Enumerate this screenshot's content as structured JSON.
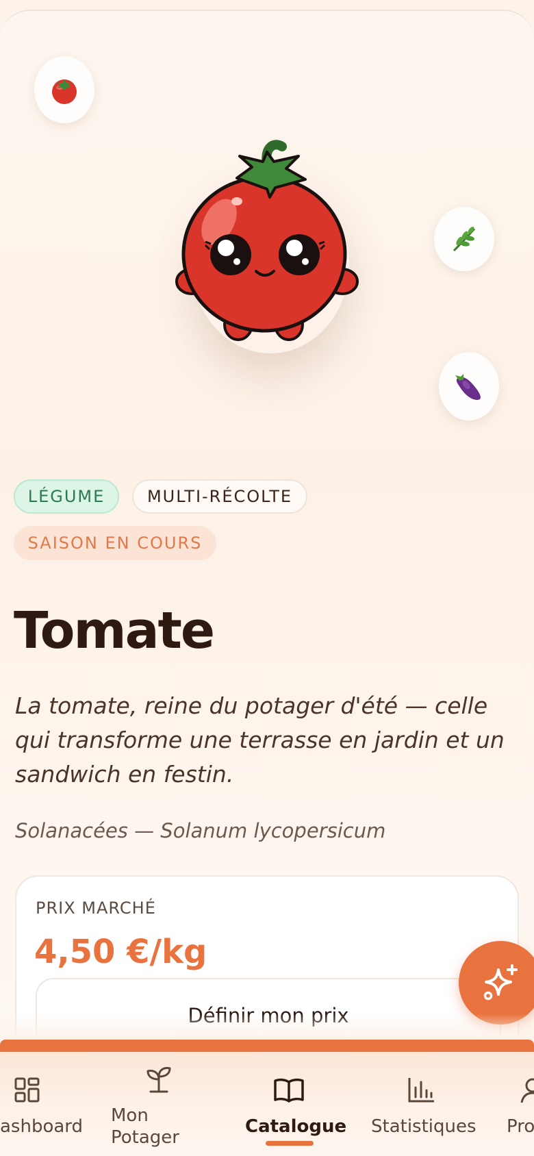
{
  "floating_icons": [
    {
      "name": "tomato-icon"
    },
    {
      "name": "herb-icon"
    },
    {
      "name": "eggplant-icon"
    }
  ],
  "tags": {
    "type": "LÉGUME",
    "harvest": "MULTI-RÉCOLTE",
    "season": "SAISON EN COURS"
  },
  "plant": {
    "name": "Tomate",
    "description": "La tomate, reine du potager d'été — celle qui transforme une terrasse en jardin et un sandwich en festin.",
    "taxonomy": "Solanacées — Solanum lycopersicum"
  },
  "price": {
    "label": "PRIX MARCHÉ",
    "value": "4,50 €/kg",
    "set_button": "Définir mon prix"
  },
  "tabs": {
    "dashboard": "ashboard",
    "potager_line1": "Mon",
    "potager_line2": "Potager",
    "catalogue": "Catalogue",
    "stats": "Statistiques",
    "profile": "Pro"
  },
  "colors": {
    "accent": "#e8733f",
    "tomato_red": "#d9352b",
    "leaf_green": "#3f8a3a",
    "chip_green_bg": "#dcf5e6",
    "chip_orange_bg": "#fbe3d5"
  }
}
